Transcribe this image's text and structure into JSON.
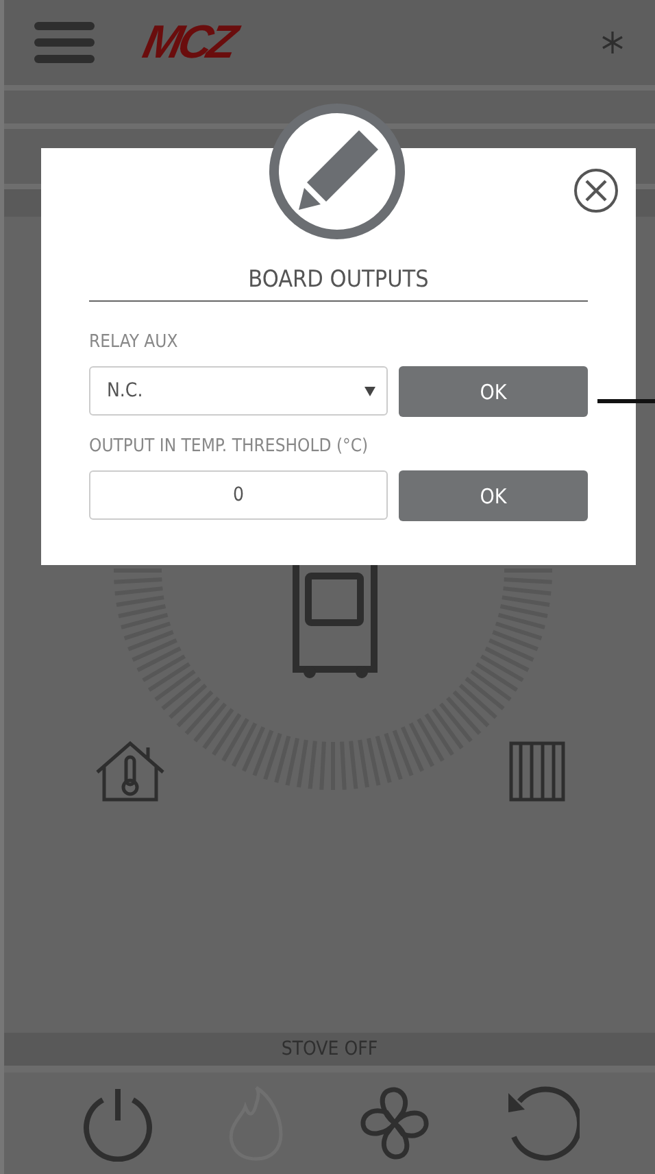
{
  "header": {
    "logo": "MCZ"
  },
  "status_bar": {
    "text": "STOVE OFF"
  },
  "toolbar": [
    {
      "kind": "power",
      "disabled": false
    },
    {
      "kind": "flame",
      "disabled": true
    },
    {
      "kind": "fan",
      "disabled": false
    },
    {
      "kind": "reset",
      "disabled": false
    }
  ],
  "dialog": {
    "title": "BOARD OUTPUTS",
    "fields": [
      {
        "kind": "select",
        "label": "RELAY AUX",
        "value": "N.C.",
        "button": "OK"
      },
      {
        "kind": "input",
        "label": "OUTPUT IN TEMP. THRESHOLD (°C)",
        "value": "0",
        "button": "OK"
      }
    ]
  }
}
